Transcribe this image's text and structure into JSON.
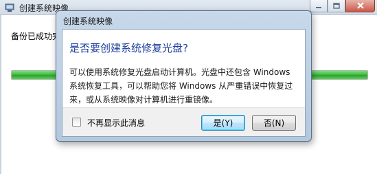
{
  "background_window": {
    "title": "创建系统映像",
    "status_text": "备份已成功完",
    "progress_percent": 100
  },
  "dialog": {
    "title": "创建系统映像",
    "heading": "是否要创建系统修复光盘?",
    "message_lines": [
      "可以使用系统修复光盘启动计算机。光盘中还包含 Windows",
      "系统恢复工具，可以帮助您将 Windows 从严重错误中恢复过",
      "来，或从系统映像对计算机进行重镜像。"
    ],
    "checkbox_label": "不再显示此消息",
    "checkbox_checked": false,
    "yes_label": "是(Y)",
    "no_label": "否(N)"
  },
  "colors": {
    "heading": "#1a3d9c",
    "progress": "#38b838",
    "dialog_frame": "#b2c8df"
  },
  "icons": [
    "app-icon",
    "minimize-icon",
    "maximize-icon",
    "close-icon"
  ]
}
